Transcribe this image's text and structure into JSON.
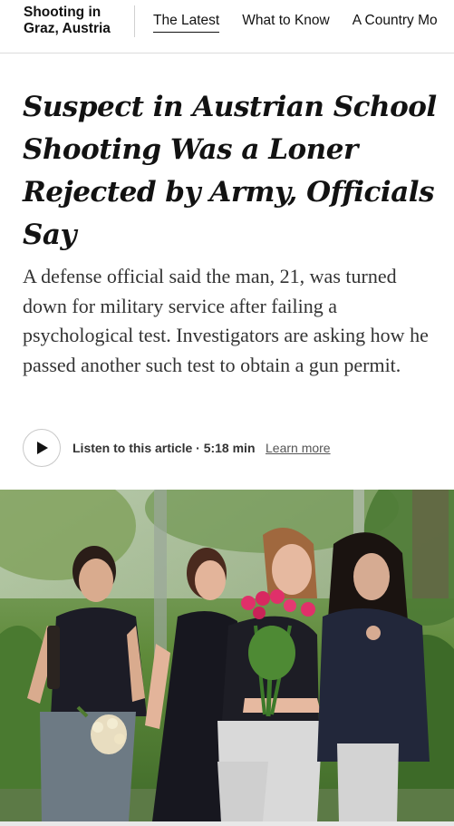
{
  "header": {
    "section_title": "Shooting in Graz, Austria",
    "tabs": [
      {
        "label": "The Latest",
        "active": true
      },
      {
        "label": "What to Know",
        "active": false
      },
      {
        "label": "A Country Mo",
        "active": false
      }
    ]
  },
  "article": {
    "headline": "Suspect in Austrian School Shooting Was a Loner Rejected by Army, Officials Say",
    "summary": "A defense official said the man, 21, was turned down for military service after failing a psychological test. Investigators are asking how he passed another such test to obtain a gun permit."
  },
  "listen": {
    "label": "Listen to this article · 5:18 min",
    "learn_more": "Learn more",
    "play_icon": "play-icon"
  },
  "photo": {
    "alt": "Young women carrying flowers walking near the school",
    "colors": {
      "foliage": "#5f8a3a",
      "shirt_dark": "#1c1c26",
      "sweatpants": "#d9d9d9",
      "roses": "#e0306a"
    }
  }
}
